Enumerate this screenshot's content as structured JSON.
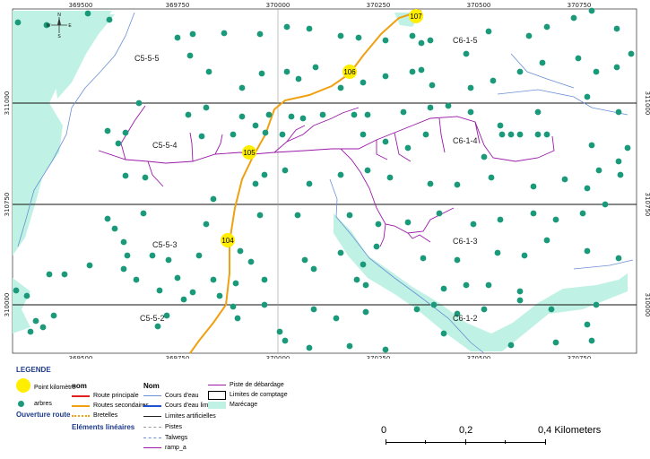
{
  "map": {
    "x_ticks": [
      "369500",
      "369750",
      "370000",
      "370250",
      "370500",
      "370750"
    ],
    "y_ticks_right": [
      "311000",
      "310750",
      "310000"
    ],
    "y_ticks_left": [
      "311000",
      "310750",
      "310000"
    ],
    "block_labels": [
      "C5-5-5",
      "C6-1-5",
      "C5-5-4",
      "C6-1-4",
      "C5-5-3",
      "C6-1-3",
      "C5-5-2",
      "C6-1-2"
    ],
    "pk_labels": [
      "107",
      "106",
      "105",
      "104"
    ],
    "compass": {
      "n": "N",
      "s": "S",
      "e": "E",
      "w": "W"
    },
    "colors": {
      "marecage": "#bff2e4",
      "arbres": "#1a9a7a",
      "route_secondaire": "#f0a010",
      "piste": "#9a1aa8",
      "cours_eau": "#6a8fd6",
      "point_km": "#ffee00"
    }
  },
  "legend": {
    "title": "LEGENDE",
    "point_km_label": "Point kilomètre",
    "arbres_label": "arbres",
    "ouverture_route_title": "Ouverture route",
    "elements_lineaires_title": "Eléments linéaires",
    "col2": {
      "header": "nom",
      "items": [
        "Route principale",
        "Routes secondaires",
        "Bretelles"
      ]
    },
    "col3": {
      "header": "Nom",
      "items": [
        "Cours d'eau",
        "Cours d'eau limites",
        "Limites artificielles",
        "Pistes",
        "Talwegs",
        "ramp_a"
      ]
    },
    "col4": {
      "items": [
        "Piste de débardage",
        "Limites de comptage",
        "Marécage"
      ]
    },
    "scale": {
      "labels": [
        "0",
        "0,2",
        "0,4 Kilometers"
      ]
    }
  }
}
